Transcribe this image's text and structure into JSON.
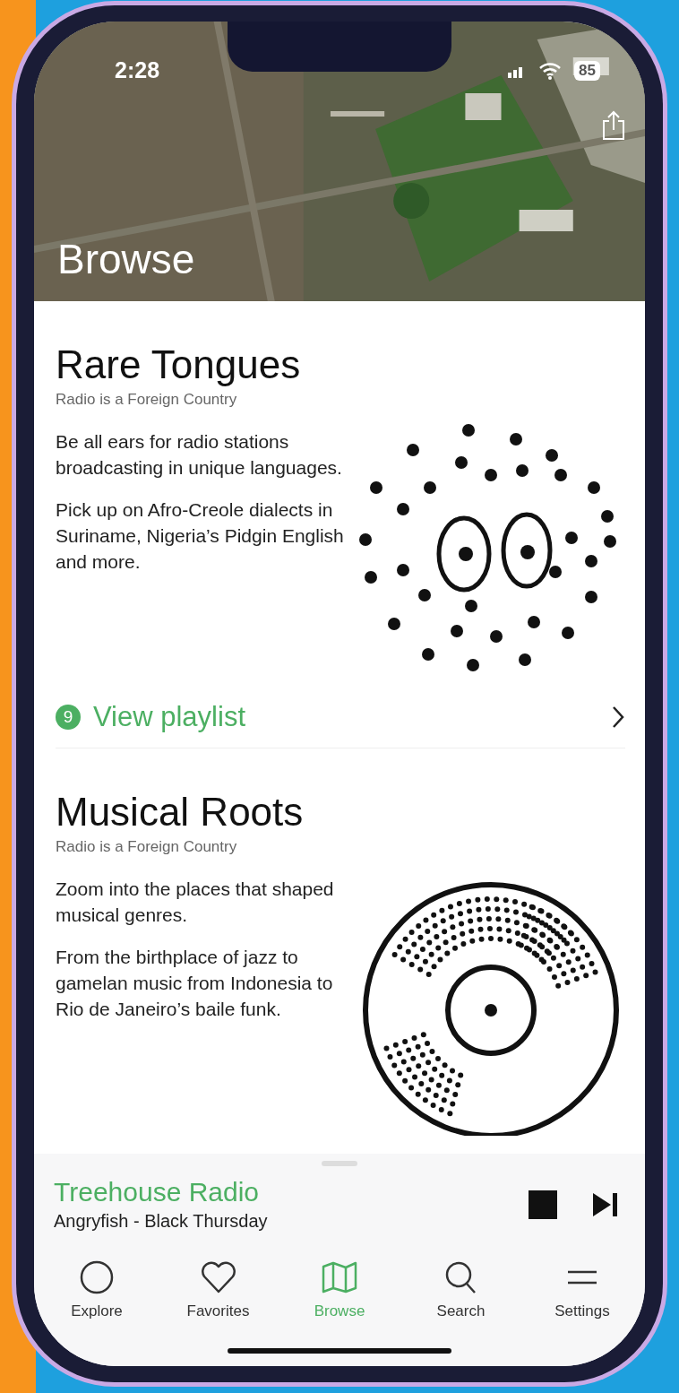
{
  "status_bar": {
    "time": "2:28",
    "battery": "85"
  },
  "header": {
    "title": "Browse"
  },
  "collections": [
    {
      "title": "Rare Tongues",
      "subtitle": "Radio is a Foreign Country",
      "paragraphs": [
        "Be all ears for radio stations broadcasting in unique languages.",
        "Pick up on Afro-Creole dialects in Suriname, Nigeria’s Pidgin English and more."
      ],
      "kind": "faces",
      "playlist": {
        "count": "9",
        "label": "View playlist"
      }
    },
    {
      "title": "Musical Roots",
      "subtitle": "Radio is a Foreign Country",
      "paragraphs": [
        "Zoom into the places that shaped musical genres.",
        "From the birthplace of jazz to gamelan music from Indonesia to Rio de Janeiro’s baile funk."
      ],
      "kind": "record"
    }
  ],
  "player": {
    "station": "Treehouse Radio",
    "track": "Angryfish - Black Thursday"
  },
  "tabs": [
    {
      "label": "Explore",
      "kind": "circle",
      "selected": false
    },
    {
      "label": "Favorites",
      "kind": "heart",
      "selected": false
    },
    {
      "label": "Browse",
      "kind": "map",
      "selected": true
    },
    {
      "label": "Search",
      "kind": "search",
      "selected": false
    },
    {
      "label": "Settings",
      "kind": "lines",
      "selected": false
    }
  ]
}
